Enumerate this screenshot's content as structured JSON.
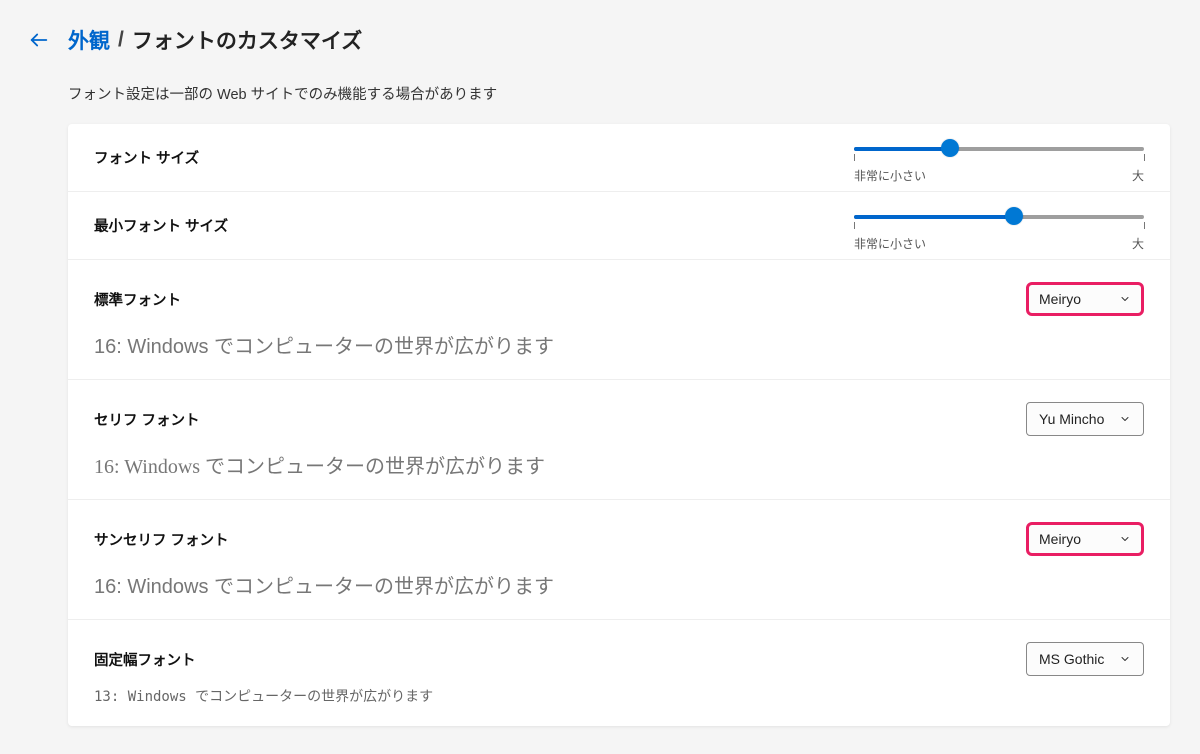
{
  "header": {
    "parent": "外観",
    "sep": "/",
    "current": "フォントのカスタマイズ"
  },
  "subtitle": "フォント設定は一部の Web サイトでのみ機能する場合があります",
  "sliders": {
    "font_size": {
      "label": "フォント サイズ",
      "min_label": "非常に小さい",
      "max_label": "大",
      "percent": 33
    },
    "min_font_size": {
      "label": "最小フォント サイズ",
      "min_label": "非常に小さい",
      "max_label": "大",
      "percent": 55
    }
  },
  "fonts": {
    "standard": {
      "label": "標準フォント",
      "sample": "16: Windows でコンピューターの世界が広がります",
      "value": "Meiryo",
      "highlight": true
    },
    "serif": {
      "label": "セリフ フォント",
      "sample": "16: Windows でコンピューターの世界が広がります",
      "value": "Yu Mincho",
      "highlight": false
    },
    "sans": {
      "label": "サンセリフ フォント",
      "sample": "16: Windows でコンピューターの世界が広がります",
      "value": "Meiryo",
      "highlight": true
    },
    "fixed": {
      "label": "固定幅フォント",
      "sample": "13: Windows でコンピューターの世界が広がります",
      "value": "MS Gothic",
      "highlight": false
    }
  }
}
